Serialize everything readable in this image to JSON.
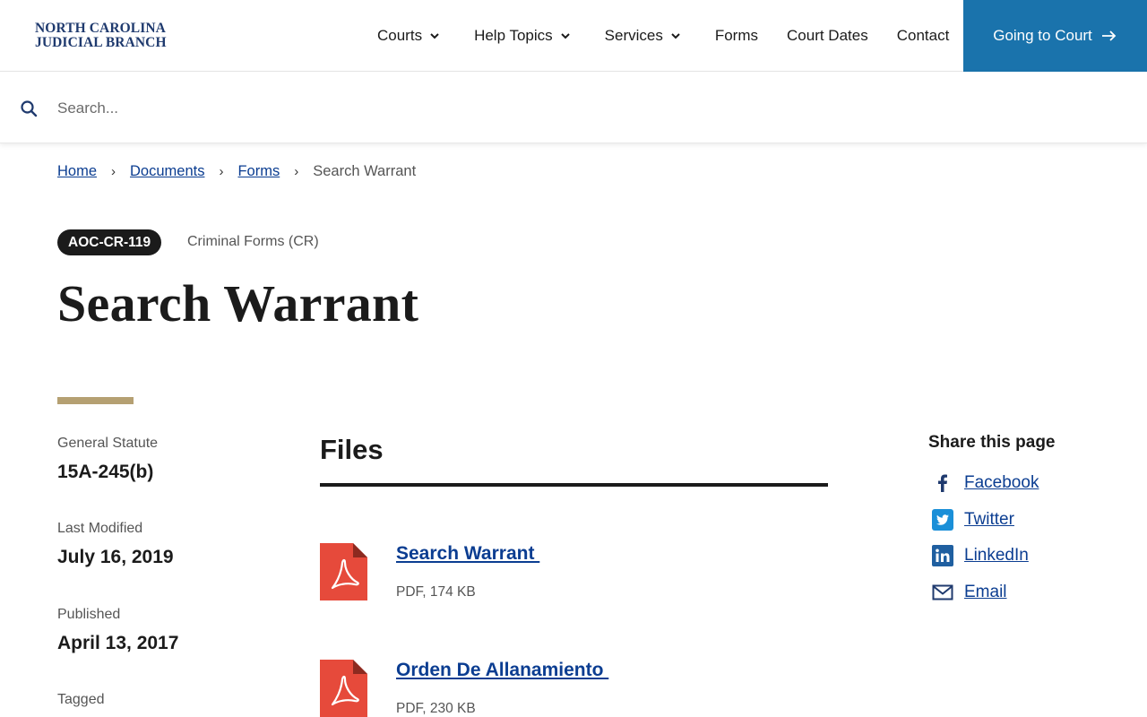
{
  "header": {
    "logo_line1": "NORTH CAROLINA",
    "logo_line2": "JUDICIAL BRANCH",
    "nav": [
      {
        "label": "Courts",
        "has_dropdown": true
      },
      {
        "label": "Help Topics",
        "has_dropdown": true
      },
      {
        "label": "Services",
        "has_dropdown": true
      },
      {
        "label": "Forms",
        "has_dropdown": false
      },
      {
        "label": "Court Dates",
        "has_dropdown": false
      },
      {
        "label": "Contact",
        "has_dropdown": false
      }
    ],
    "cta_label": "Going to Court",
    "cta_icon": "arrow-right-icon",
    "cta_color": "#1a73ac"
  },
  "search": {
    "placeholder": "Search...",
    "value": "",
    "icon": "search-icon"
  },
  "breadcrumb": {
    "items": [
      "Home",
      "Documents",
      "Forms"
    ],
    "current": "Search Warrant"
  },
  "form": {
    "code": "AOC-CR-119",
    "category": "Criminal Forms (CR)",
    "title": "Search Warrant"
  },
  "meta": {
    "statute_label": "General Statute",
    "statute_value": "15A-245(b)",
    "modified_label": "Last Modified",
    "modified_value": "July 16, 2019",
    "published_label": "Published",
    "published_value": "April 13, 2017",
    "tagged_label": "Tagged"
  },
  "files": {
    "heading": "Files",
    "items": [
      {
        "name": "Search Warrant ",
        "info": "PDF, 174 KB",
        "icon": "pdf-icon"
      },
      {
        "name": "Orden De Allanamiento ",
        "info": "PDF, 230 KB",
        "icon": "pdf-icon"
      }
    ]
  },
  "share": {
    "title": "Share this page",
    "items": [
      {
        "label": "Facebook",
        "icon": "facebook-icon"
      },
      {
        "label": "Twitter",
        "icon": "twitter-icon"
      },
      {
        "label": "LinkedIn",
        "icon": "linkedin-icon"
      },
      {
        "label": "Email",
        "icon": "email-icon"
      }
    ]
  },
  "colors": {
    "link": "#0b3d91",
    "accent": "#b5a072",
    "pdf_red": "#e64a3b",
    "brand_blue": "#1f3a6e"
  }
}
